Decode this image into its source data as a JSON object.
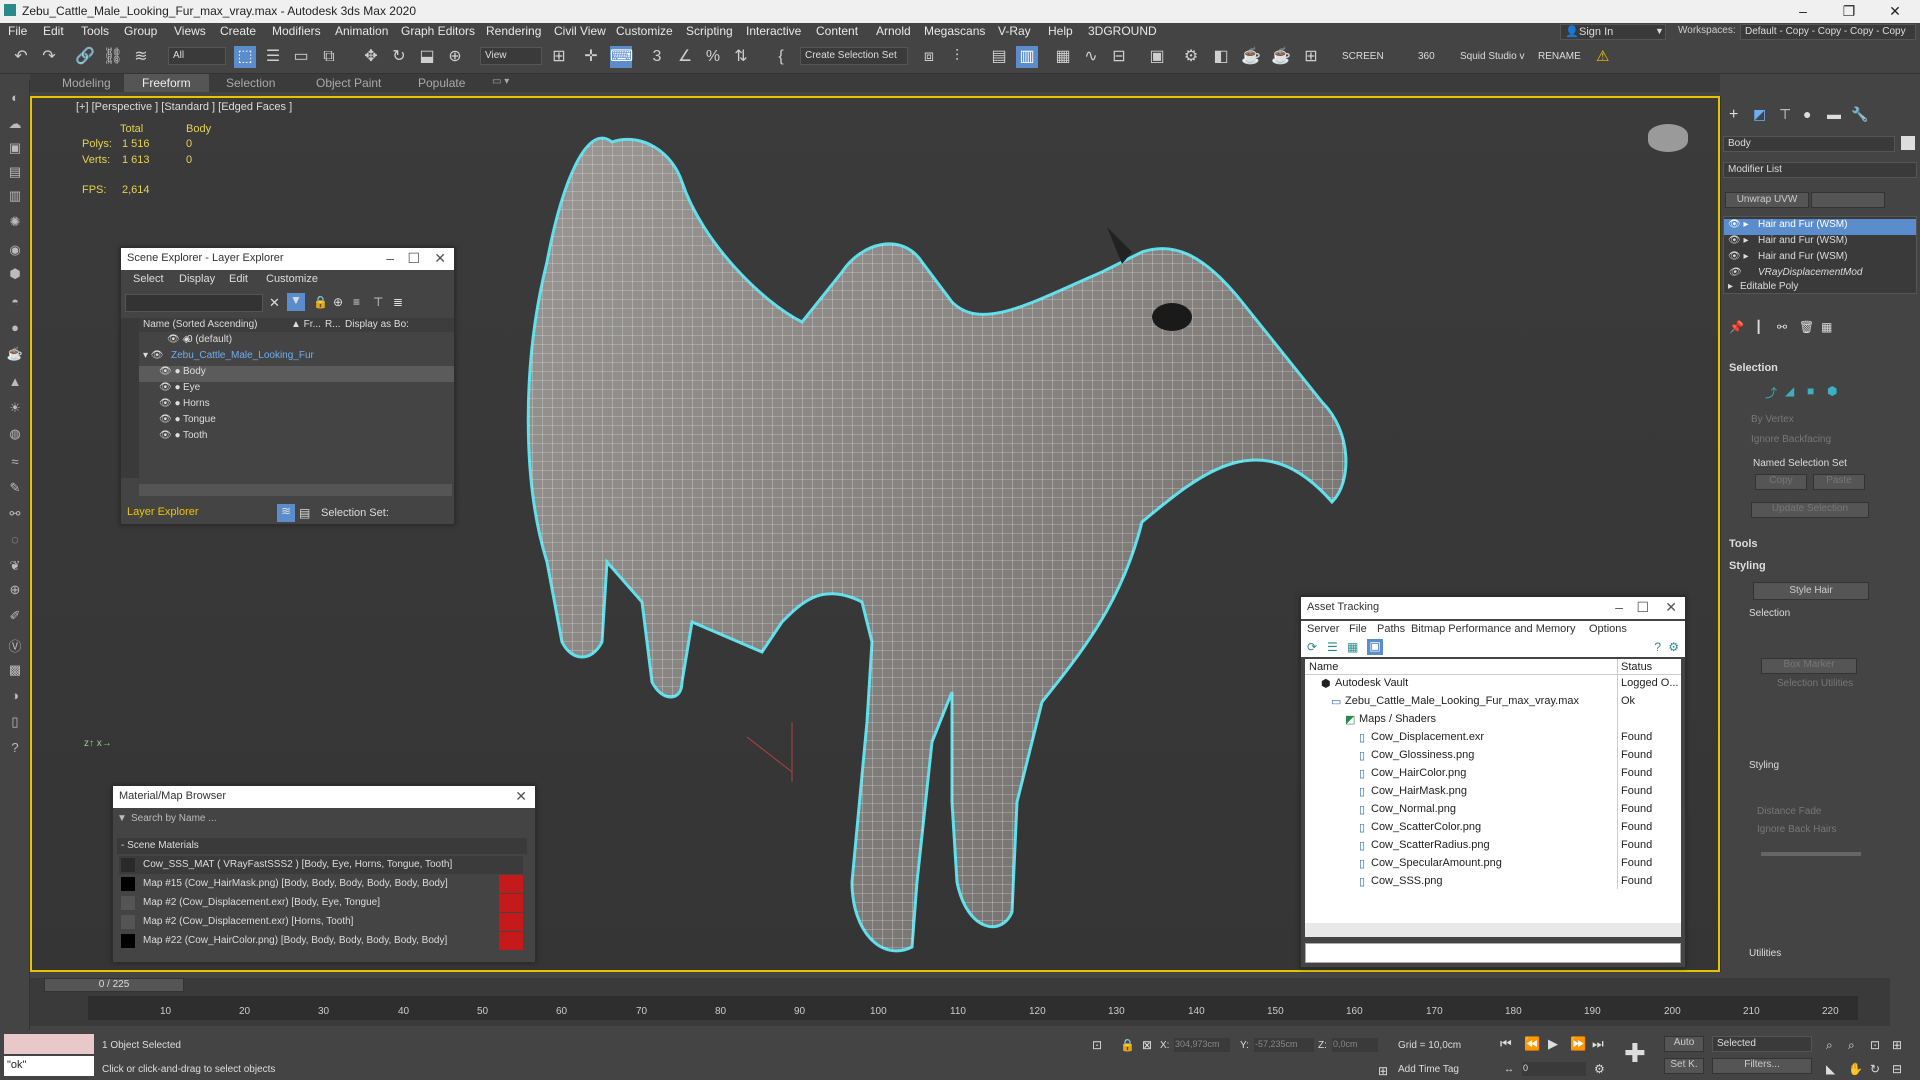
{
  "title": "Zebu_Cattle_Male_Looking_Fur_max_vray.max - Autodesk 3ds Max 2020",
  "menu": [
    "File",
    "Edit",
    "Tools",
    "Group",
    "Views",
    "Create",
    "Modifiers",
    "Animation",
    "Graph Editors",
    "Rendering",
    "Civil View",
    "Customize",
    "Scripting",
    "Interactive",
    "Content",
    "Arnold",
    "Megascans",
    "V-Ray",
    "Help",
    "3DGROUND"
  ],
  "sign_in": "Sign In",
  "workspaces_label": "Workspaces:",
  "workspaces_value": "Default - Copy - Copy - Copy - Copy",
  "toolbar": {
    "filter": "All",
    "view": "View",
    "sel_set": "Create Selection Set",
    "screen": "SCREEN",
    "num": "360",
    "squid": "Squid Studio v",
    "rename": "RENAME"
  },
  "ribbon": [
    "Modeling",
    "Freeform",
    "Selection",
    "Object Paint",
    "Populate"
  ],
  "viewport": {
    "label": "[+] [Perspective ] [Standard ] [Edged Faces ]",
    "col_total": "Total",
    "col_body": "Body",
    "polys_label": "Polys:",
    "polys_total": "1 516",
    "polys_body": "0",
    "verts_label": "Verts:",
    "verts_total": "1 613",
    "verts_body": "0",
    "fps_label": "FPS:",
    "fps": "2,614"
  },
  "scene_explorer": {
    "title": "Scene Explorer - Layer Explorer",
    "menu": [
      "Select",
      "Display",
      "Edit",
      "Customize"
    ],
    "col_name": "Name (Sorted Ascending)",
    "col_fr": "▲ Fr...",
    "col_r": "R...",
    "col_disp": "Display as Bo:",
    "rows": [
      "0 (default)",
      "Zebu_Cattle_Male_Looking_Fur",
      "Body",
      "Eye",
      "Horns",
      "Tongue",
      "Tooth"
    ],
    "footer_dd": "Layer Explorer",
    "footer_sel": "Selection Set:"
  },
  "material_browser": {
    "title": "Material/Map Browser",
    "search": "Search by Name ...",
    "section": "- Scene Materials",
    "rows": [
      "Cow_SSS_MAT  ( VRayFastSSS2 )  [Body, Eye, Horns, Tongue, Tooth]",
      "Map #15 (Cow_HairMask.png)  [Body, Body, Body, Body, Body, Body]",
      "Map #2 (Cow_Displacement.exr)  [Body, Eye, Tongue]",
      "Map #2 (Cow_Displacement.exr)  [Horns, Tooth]",
      "Map #22 (Cow_HairColor.png)  [Body, Body, Body, Body, Body, Body]"
    ]
  },
  "asset_tracking": {
    "title": "Asset Tracking",
    "menu": [
      "Server",
      "File",
      "Paths",
      "Bitmap Performance and Memory",
      "Options"
    ],
    "col_name": "Name",
    "col_status": "Status",
    "rows": [
      {
        "name": "Autodesk Vault",
        "status": "Logged O..."
      },
      {
        "name": "Zebu_Cattle_Male_Looking_Fur_max_vray.max",
        "status": "Ok"
      },
      {
        "name": "Maps / Shaders",
        "status": ""
      },
      {
        "name": "Cow_Displacement.exr",
        "status": "Found"
      },
      {
        "name": "Cow_Glossiness.png",
        "status": "Found"
      },
      {
        "name": "Cow_HairColor.png",
        "status": "Found"
      },
      {
        "name": "Cow_HairMask.png",
        "status": "Found"
      },
      {
        "name": "Cow_Normal.png",
        "status": "Found"
      },
      {
        "name": "Cow_ScatterColor.png",
        "status": "Found"
      },
      {
        "name": "Cow_ScatterRadius.png",
        "status": "Found"
      },
      {
        "name": "Cow_SpecularAmount.png",
        "status": "Found"
      },
      {
        "name": "Cow_SSS.png",
        "status": "Found"
      }
    ]
  },
  "command_panel": {
    "object_name": "Body",
    "modifier_list": "Modifier List",
    "unwrap": "Unwrap UVW",
    "stack": [
      "Hair and Fur (WSM)",
      "Hair and Fur (WSM)",
      "Hair and Fur (WSM)",
      "VRayDisplacementMod",
      "Editable Poly"
    ],
    "selection": "Selection",
    "by_vertex": "By Vertex",
    "ignore_backfacing": "Ignore Backfacing",
    "named_sel": "Named Selection Set",
    "copy": "Copy",
    "paste": "Paste",
    "update_sel": "Update Selection",
    "tools": "Tools",
    "styling": "Styling",
    "style_hair": "Style Hair",
    "selection2": "Selection",
    "box_marker": "Box Marker",
    "sel_utils": "Selection Utilities",
    "styling2": "Styling",
    "distance_fade": "Distance Fade",
    "ignore_back_hairs": "Ignore Back Hairs",
    "utilities": "Utilities"
  },
  "timeline": {
    "frame": "0 / 225",
    "ticks": [
      "10",
      "20",
      "30",
      "40",
      "50",
      "60",
      "70",
      "80",
      "90",
      "100",
      "110",
      "120",
      "130",
      "140",
      "150",
      "160",
      "170",
      "180",
      "190",
      "200",
      "210",
      "220"
    ]
  },
  "status": {
    "maxscript": "\"ok\"",
    "selected": "1 Object Selected",
    "prompt": "Click or click-and-drag to select objects",
    "x_label": "X:",
    "x": "304,973cm",
    "y_label": "Y:",
    "y": "-57,235cm",
    "z_label": "Z:",
    "z": "0,0cm",
    "grid": "Grid = 10,0cm",
    "add_time_tag": "Add Time Tag",
    "auto": "Auto",
    "set_key": "Set K.",
    "selected_dd": "Selected",
    "filters": "Filters...",
    "frame_field": "0"
  }
}
